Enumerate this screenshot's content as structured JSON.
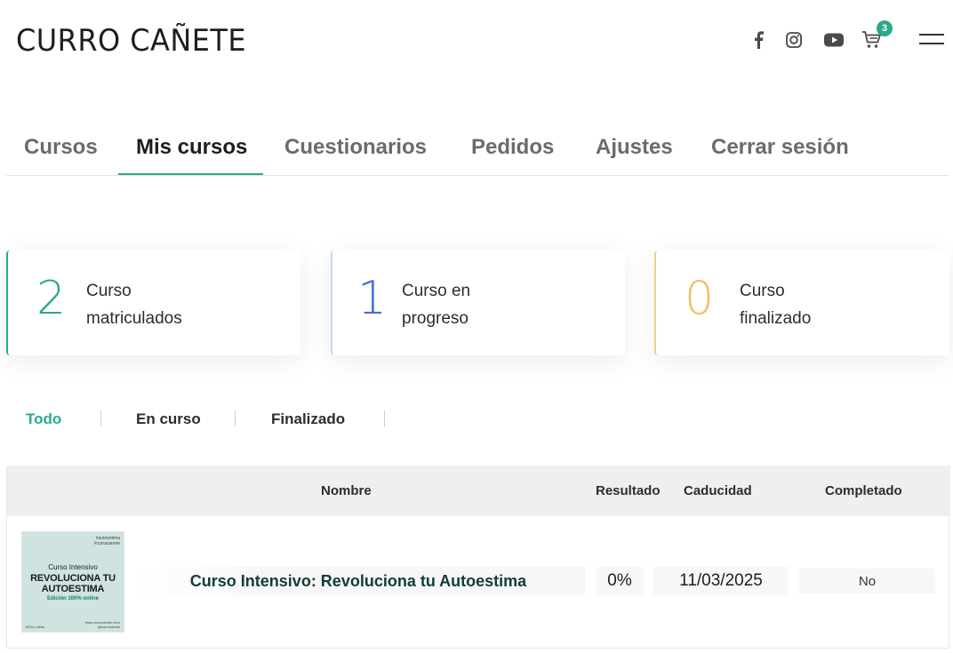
{
  "header": {
    "logo": "CURRO CAÑETE",
    "cart_count": "3",
    "icons": [
      "facebook-icon",
      "instagram-icon",
      "youtube-icon",
      "cart-icon",
      "menu-icon"
    ]
  },
  "tabs": [
    {
      "label": "Cursos"
    },
    {
      "label": "Mis cursos"
    },
    {
      "label": "Cuestionarios"
    },
    {
      "label": "Pedidos"
    },
    {
      "label": "Ajustes"
    },
    {
      "label": "Cerrar sesión"
    }
  ],
  "active_tab": "Mis cursos",
  "stats": [
    {
      "value": "2",
      "label_line1": "Curso",
      "label_line2": "matriculados",
      "color": "#2aa98e"
    },
    {
      "value": "1",
      "label_line1": "Curso en",
      "label_line2": "progreso",
      "color": "#3f6fdc"
    },
    {
      "value": "0",
      "label_line1": "Curso",
      "label_line2": "finalizado",
      "color": "#f0c064"
    }
  ],
  "filters": [
    {
      "label": "Todo"
    },
    {
      "label": "En curso"
    },
    {
      "label": "Finalizado"
    }
  ],
  "active_filter": "Todo",
  "table": {
    "headers": {
      "name": "Nombre",
      "result": "Resultado",
      "expiry": "Caducidad",
      "completed": "Completado"
    },
    "rows": [
      {
        "thumbnail": {
          "tag1": "#autoestima",
          "tag2": "#curracanete",
          "subtitle": "Curso Intensivo",
          "title_line1": "REVOLUCIONA TU",
          "title_line2": "AUTOESTIMA",
          "edition": "Edición 100% online",
          "footer1": "www.currocanete.com",
          "footer2": "@currocanete",
          "footer_left": "100% online"
        },
        "name": "Curso Intensivo: Revoluciona tu Autoestima",
        "result": "0%",
        "expiry": "11/03/2025",
        "completed": "No"
      }
    ]
  },
  "accent_color": "#2aa98e"
}
